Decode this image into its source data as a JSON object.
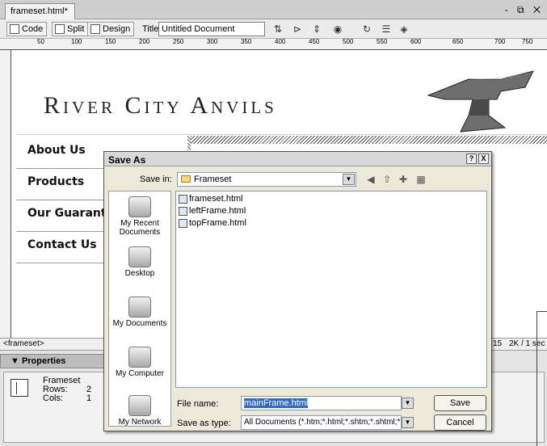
{
  "document_tab": {
    "label": "frameset.html*"
  },
  "window_controls": "- ⧉ ✕",
  "toolbar": {
    "code_label": "Code",
    "split_label": "Split",
    "design_label": "Design",
    "title_label": "Title:",
    "title_value": "Untitled Document",
    "icons": [
      "file-management-icon",
      "preview-icon",
      "debug-icon",
      "browser-check-icon",
      "refresh-icon",
      "view-options-icon",
      "visual-aids-icon"
    ]
  },
  "ruler": {
    "labels": [
      "50",
      "100",
      "150",
      "200",
      "250",
      "300",
      "350",
      "400",
      "450",
      "500",
      "550",
      "600",
      "650",
      "700",
      "750"
    ]
  },
  "page": {
    "banner_title": "River City Anvils",
    "nav": [
      "About Us",
      "Products",
      "Our Guarantee",
      "Contact Us"
    ]
  },
  "status_bar": {
    "tag_selector": "<frameset>",
    "zoom": "15",
    "size": "2K / 1 sec"
  },
  "properties": {
    "header": "▼ Properties",
    "type": "Frameset",
    "rows_label": "Rows:",
    "rows_value": "2",
    "cols_label": "Cols:",
    "cols_value": "1"
  },
  "save_dialog": {
    "title": "Save As",
    "title_buttons": [
      "?",
      "X"
    ],
    "save_in_label": "Save in:",
    "save_in_value": "Frameset",
    "places": [
      "My Recent Documents",
      "Desktop",
      "My Documents",
      "My Computer",
      "My Network"
    ],
    "files": [
      "frameset.html",
      "leftFrame.html",
      "topFrame.html"
    ],
    "file_name_label": "File name:",
    "file_name_value": "mainFrame.html",
    "save_as_type_label": "Save as type:",
    "save_as_type_value": "All Documents (*.htm;*.html;*.shtm;*.shtml;*.hta;",
    "save_button": "Save",
    "cancel_button": "Cancel"
  },
  "colors": {
    "selection": "#316ac5",
    "dialog_bg": "#ece9d8"
  }
}
